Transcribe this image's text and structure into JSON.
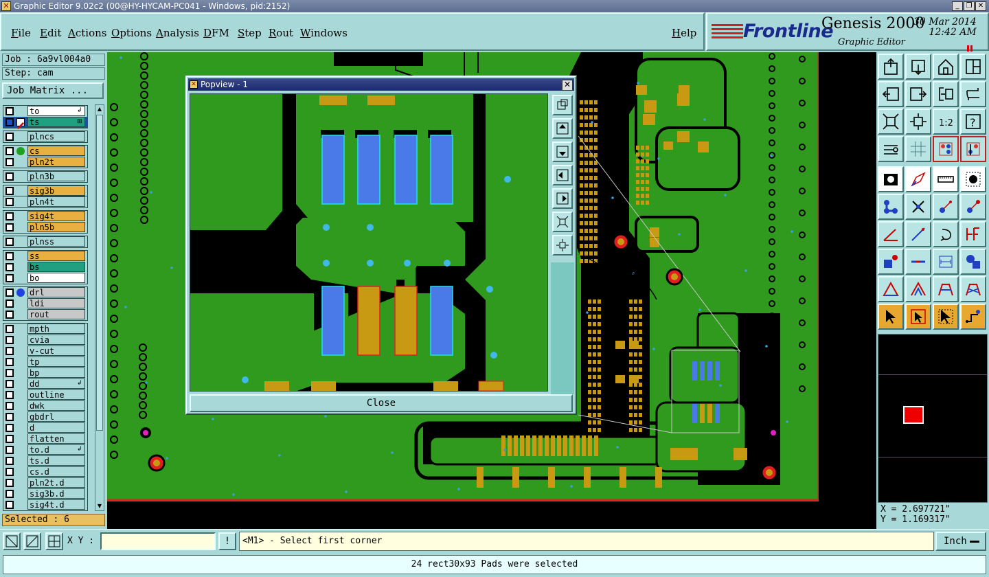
{
  "window": {
    "title": "Graphic Editor 9.02c2 (00@HY-HYCAM-PC041 - Windows, pid:2152)",
    "btn_minimize": "_",
    "btn_restore": "❐",
    "btn_close": "✕"
  },
  "menu": [
    "File",
    "Edit",
    "Actions",
    "Options",
    "Analysis",
    "DFM",
    "Step",
    "Rout",
    "Windows"
  ],
  "help": "Help",
  "brand": {
    "company": "Frontline",
    "product": "Genesis 2000",
    "subtitle": "Graphic Editor",
    "date": "30 Mar 2014",
    "time": "12:42 AM"
  },
  "job": {
    "job_label": "Job : 6a9vl004a0",
    "step_label": "Step: cam",
    "matrix_button": "Job Matrix ..."
  },
  "layers": [
    {
      "name": "to",
      "state": "white",
      "flag": "↲"
    },
    {
      "name": "ts",
      "state": "teal",
      "flag": "⊞"
    },
    {
      "name": "plncs",
      "state": "off"
    },
    {
      "name": "cs",
      "state": "orange"
    },
    {
      "name": "pln2t",
      "state": "orange"
    },
    {
      "name": "pln3b",
      "state": "off"
    },
    {
      "name": "sig3b",
      "state": "orange"
    },
    {
      "name": "pln4t",
      "state": "off"
    },
    {
      "name": "sig4t",
      "state": "orange"
    },
    {
      "name": "pln5b",
      "state": "orange"
    },
    {
      "name": "plnss",
      "state": "off"
    },
    {
      "name": "ss",
      "state": "orange"
    },
    {
      "name": "bs",
      "state": "teal"
    },
    {
      "name": "bo",
      "state": "white"
    },
    {
      "name": "drl",
      "state": "gray"
    },
    {
      "name": "ldi",
      "state": "gray"
    },
    {
      "name": "rout",
      "state": "gray"
    },
    {
      "name": "mpth",
      "state": "off"
    },
    {
      "name": "cvia",
      "state": "off"
    },
    {
      "name": "v-cut",
      "state": "off"
    },
    {
      "name": "tp",
      "state": "off"
    },
    {
      "name": "bp",
      "state": "off"
    },
    {
      "name": "dd",
      "state": "off",
      "flag": "↲"
    },
    {
      "name": "outline",
      "state": "off"
    },
    {
      "name": "dwk",
      "state": "off"
    },
    {
      "name": "gbdrl",
      "state": "off"
    },
    {
      "name": "d",
      "state": "off"
    },
    {
      "name": "flatten",
      "state": "off"
    },
    {
      "name": "to.d",
      "state": "off",
      "flag": "↲"
    },
    {
      "name": "ts.d",
      "state": "off"
    },
    {
      "name": "cs.d",
      "state": "off"
    },
    {
      "name": "pln2t.d",
      "state": "off"
    },
    {
      "name": "sig3b.d",
      "state": "off"
    },
    {
      "name": "sig4t.d",
      "state": "off"
    }
  ],
  "selected_count": "Selected : 6",
  "popview": {
    "title": "Popview - 1",
    "close_label": "Close"
  },
  "coords": {
    "x": "X = 2.697721\"",
    "y": "Y = 1.169317\""
  },
  "cmd": {
    "xy_label": "X Y :",
    "xy_value": "",
    "bang": "!",
    "prompt": "<M1> - Select first corner",
    "unit": "Inch"
  },
  "status_message": "24 rect30x93 Pads were selected",
  "colors": {
    "board_green": "#2f9a1e",
    "copper_orange": "#c89a14",
    "pad_blue": "#4a7ae8",
    "selection_red": "#e02020",
    "panel_teal": "#a8d8d8"
  }
}
